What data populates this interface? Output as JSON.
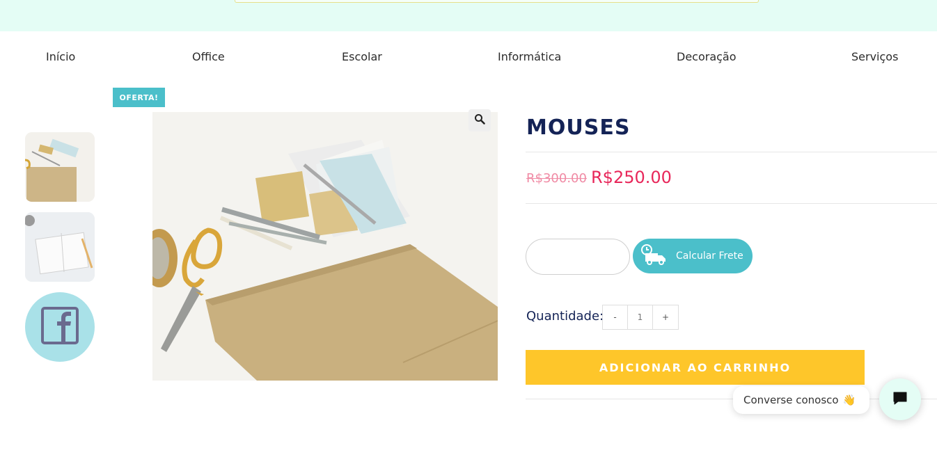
{
  "nav": {
    "items": [
      {
        "label": "Início"
      },
      {
        "label": "Office"
      },
      {
        "label": "Escolar"
      },
      {
        "label": "Informática"
      },
      {
        "label": "Decoração"
      },
      {
        "label": "Serviços"
      }
    ]
  },
  "product": {
    "badge": "OFERTA!",
    "title": "MOUSES",
    "old_price": "R$300.00",
    "new_price": "R$250.00",
    "shipping": {
      "cep_placeholder": "",
      "button_label": "Calcular Frete"
    },
    "quantity": {
      "label": "Quantidade:",
      "minus": "-",
      "value": "1",
      "plus": "+"
    },
    "add_to_cart": "ADICIONAR AO CARRINHO"
  },
  "gallery": {
    "icons": [
      "zoom-icon",
      "facebook-icon"
    ]
  },
  "chat": {
    "label": "Converse conosco",
    "emoji": "👋"
  },
  "colors": {
    "accent": "#4bbfca",
    "price": "#e8275a",
    "cart": "#fec62a",
    "topbar": "#e4fdf5"
  }
}
